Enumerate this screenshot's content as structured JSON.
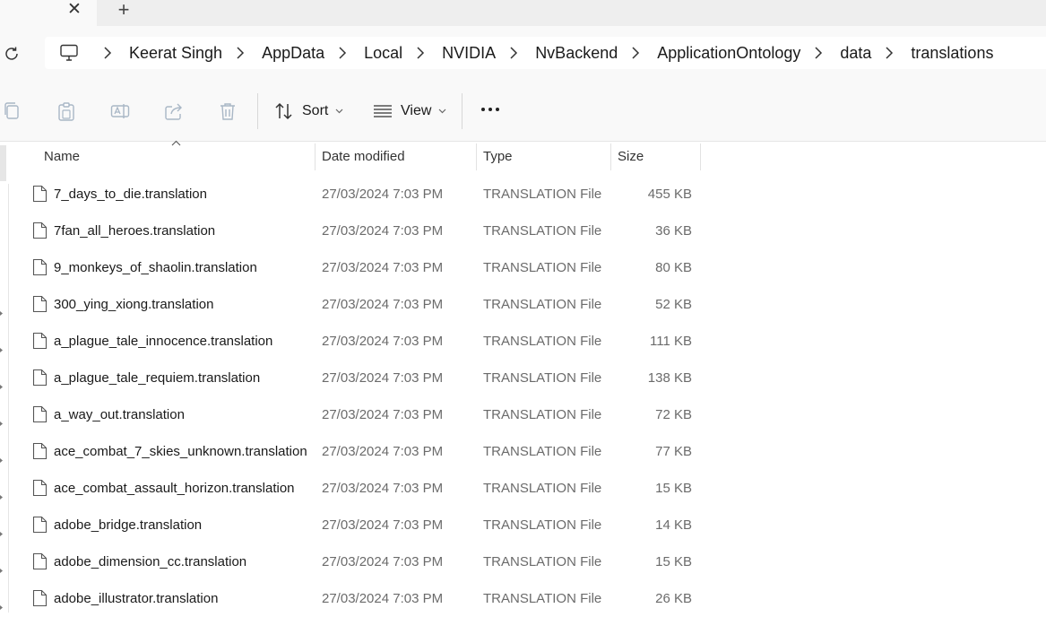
{
  "tabs": {
    "close_label": "✕",
    "new_tab_label": "+"
  },
  "breadcrumb": [
    "Keerat Singh",
    "AppData",
    "Local",
    "NVIDIA",
    "NvBackend",
    "ApplicationOntology",
    "data",
    "translations"
  ],
  "toolbar": {
    "sort_label": "Sort",
    "view_label": "View",
    "more_label": "•••"
  },
  "columns": {
    "name": "Name",
    "date_modified": "Date modified",
    "type": "Type",
    "size": "Size"
  },
  "files": [
    {
      "name": "7_days_to_die.translation",
      "date": "27/03/2024 7:03 PM",
      "type": "TRANSLATION File",
      "size": "455 KB"
    },
    {
      "name": "7fan_all_heroes.translation",
      "date": "27/03/2024 7:03 PM",
      "type": "TRANSLATION File",
      "size": "36 KB"
    },
    {
      "name": "9_monkeys_of_shaolin.translation",
      "date": "27/03/2024 7:03 PM",
      "type": "TRANSLATION File",
      "size": "80 KB"
    },
    {
      "name": "300_ying_xiong.translation",
      "date": "27/03/2024 7:03 PM",
      "type": "TRANSLATION File",
      "size": "52 KB"
    },
    {
      "name": "a_plague_tale_innocence.translation",
      "date": "27/03/2024 7:03 PM",
      "type": "TRANSLATION File",
      "size": "111 KB"
    },
    {
      "name": "a_plague_tale_requiem.translation",
      "date": "27/03/2024 7:03 PM",
      "type": "TRANSLATION File",
      "size": "138 KB"
    },
    {
      "name": "a_way_out.translation",
      "date": "27/03/2024 7:03 PM",
      "type": "TRANSLATION File",
      "size": "72 KB"
    },
    {
      "name": "ace_combat_7_skies_unknown.translation",
      "date": "27/03/2024 7:03 PM",
      "type": "TRANSLATION File",
      "size": "77 KB"
    },
    {
      "name": "ace_combat_assault_horizon.translation",
      "date": "27/03/2024 7:03 PM",
      "type": "TRANSLATION File",
      "size": "15 KB"
    },
    {
      "name": "adobe_bridge.translation",
      "date": "27/03/2024 7:03 PM",
      "type": "TRANSLATION File",
      "size": "14 KB"
    },
    {
      "name": "adobe_dimension_cc.translation",
      "date": "27/03/2024 7:03 PM",
      "type": "TRANSLATION File",
      "size": "15 KB"
    },
    {
      "name": "adobe_illustrator.translation",
      "date": "27/03/2024 7:03 PM",
      "type": "TRANSLATION File",
      "size": "26 KB"
    }
  ],
  "colors": {
    "toolbar_bg": "#f9f9f9",
    "tabstrip_bg": "#eeeeee",
    "icon_disabled": "#a9b7c6",
    "muted_text": "#6b6b6b"
  }
}
